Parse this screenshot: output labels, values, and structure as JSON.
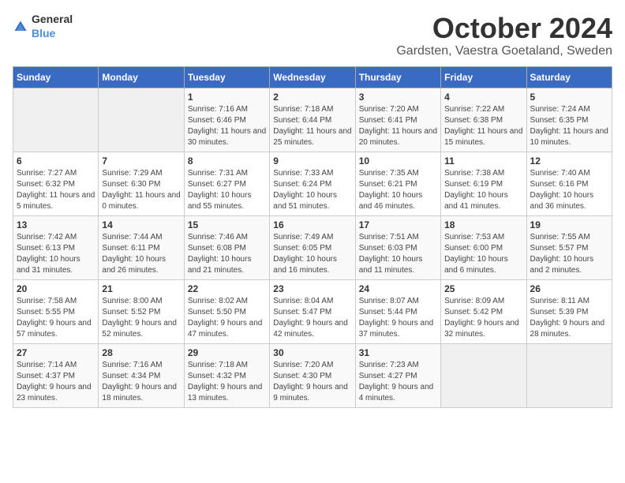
{
  "logo": {
    "general": "General",
    "blue": "Blue"
  },
  "header": {
    "month_year": "October 2024",
    "location": "Gardsten, Vaestra Goetaland, Sweden"
  },
  "weekdays": [
    "Sunday",
    "Monday",
    "Tuesday",
    "Wednesday",
    "Thursday",
    "Friday",
    "Saturday"
  ],
  "weeks": [
    [
      {
        "day": "",
        "sunrise": "",
        "sunset": "",
        "daylight": ""
      },
      {
        "day": "",
        "sunrise": "",
        "sunset": "",
        "daylight": ""
      },
      {
        "day": "1",
        "sunrise": "Sunrise: 7:16 AM",
        "sunset": "Sunset: 6:46 PM",
        "daylight": "Daylight: 11 hours and 30 minutes."
      },
      {
        "day": "2",
        "sunrise": "Sunrise: 7:18 AM",
        "sunset": "Sunset: 6:44 PM",
        "daylight": "Daylight: 11 hours and 25 minutes."
      },
      {
        "day": "3",
        "sunrise": "Sunrise: 7:20 AM",
        "sunset": "Sunset: 6:41 PM",
        "daylight": "Daylight: 11 hours and 20 minutes."
      },
      {
        "day": "4",
        "sunrise": "Sunrise: 7:22 AM",
        "sunset": "Sunset: 6:38 PM",
        "daylight": "Daylight: 11 hours and 15 minutes."
      },
      {
        "day": "5",
        "sunrise": "Sunrise: 7:24 AM",
        "sunset": "Sunset: 6:35 PM",
        "daylight": "Daylight: 11 hours and 10 minutes."
      }
    ],
    [
      {
        "day": "6",
        "sunrise": "Sunrise: 7:27 AM",
        "sunset": "Sunset: 6:32 PM",
        "daylight": "Daylight: 11 hours and 5 minutes."
      },
      {
        "day": "7",
        "sunrise": "Sunrise: 7:29 AM",
        "sunset": "Sunset: 6:30 PM",
        "daylight": "Daylight: 11 hours and 0 minutes."
      },
      {
        "day": "8",
        "sunrise": "Sunrise: 7:31 AM",
        "sunset": "Sunset: 6:27 PM",
        "daylight": "Daylight: 10 hours and 55 minutes."
      },
      {
        "day": "9",
        "sunrise": "Sunrise: 7:33 AM",
        "sunset": "Sunset: 6:24 PM",
        "daylight": "Daylight: 10 hours and 51 minutes."
      },
      {
        "day": "10",
        "sunrise": "Sunrise: 7:35 AM",
        "sunset": "Sunset: 6:21 PM",
        "daylight": "Daylight: 10 hours and 46 minutes."
      },
      {
        "day": "11",
        "sunrise": "Sunrise: 7:38 AM",
        "sunset": "Sunset: 6:19 PM",
        "daylight": "Daylight: 10 hours and 41 minutes."
      },
      {
        "day": "12",
        "sunrise": "Sunrise: 7:40 AM",
        "sunset": "Sunset: 6:16 PM",
        "daylight": "Daylight: 10 hours and 36 minutes."
      }
    ],
    [
      {
        "day": "13",
        "sunrise": "Sunrise: 7:42 AM",
        "sunset": "Sunset: 6:13 PM",
        "daylight": "Daylight: 10 hours and 31 minutes."
      },
      {
        "day": "14",
        "sunrise": "Sunrise: 7:44 AM",
        "sunset": "Sunset: 6:11 PM",
        "daylight": "Daylight: 10 hours and 26 minutes."
      },
      {
        "day": "15",
        "sunrise": "Sunrise: 7:46 AM",
        "sunset": "Sunset: 6:08 PM",
        "daylight": "Daylight: 10 hours and 21 minutes."
      },
      {
        "day": "16",
        "sunrise": "Sunrise: 7:49 AM",
        "sunset": "Sunset: 6:05 PM",
        "daylight": "Daylight: 10 hours and 16 minutes."
      },
      {
        "day": "17",
        "sunrise": "Sunrise: 7:51 AM",
        "sunset": "Sunset: 6:03 PM",
        "daylight": "Daylight: 10 hours and 11 minutes."
      },
      {
        "day": "18",
        "sunrise": "Sunrise: 7:53 AM",
        "sunset": "Sunset: 6:00 PM",
        "daylight": "Daylight: 10 hours and 6 minutes."
      },
      {
        "day": "19",
        "sunrise": "Sunrise: 7:55 AM",
        "sunset": "Sunset: 5:57 PM",
        "daylight": "Daylight: 10 hours and 2 minutes."
      }
    ],
    [
      {
        "day": "20",
        "sunrise": "Sunrise: 7:58 AM",
        "sunset": "Sunset: 5:55 PM",
        "daylight": "Daylight: 9 hours and 57 minutes."
      },
      {
        "day": "21",
        "sunrise": "Sunrise: 8:00 AM",
        "sunset": "Sunset: 5:52 PM",
        "daylight": "Daylight: 9 hours and 52 minutes."
      },
      {
        "day": "22",
        "sunrise": "Sunrise: 8:02 AM",
        "sunset": "Sunset: 5:50 PM",
        "daylight": "Daylight: 9 hours and 47 minutes."
      },
      {
        "day": "23",
        "sunrise": "Sunrise: 8:04 AM",
        "sunset": "Sunset: 5:47 PM",
        "daylight": "Daylight: 9 hours and 42 minutes."
      },
      {
        "day": "24",
        "sunrise": "Sunrise: 8:07 AM",
        "sunset": "Sunset: 5:44 PM",
        "daylight": "Daylight: 9 hours and 37 minutes."
      },
      {
        "day": "25",
        "sunrise": "Sunrise: 8:09 AM",
        "sunset": "Sunset: 5:42 PM",
        "daylight": "Daylight: 9 hours and 32 minutes."
      },
      {
        "day": "26",
        "sunrise": "Sunrise: 8:11 AM",
        "sunset": "Sunset: 5:39 PM",
        "daylight": "Daylight: 9 hours and 28 minutes."
      }
    ],
    [
      {
        "day": "27",
        "sunrise": "Sunrise: 7:14 AM",
        "sunset": "Sunset: 4:37 PM",
        "daylight": "Daylight: 9 hours and 23 minutes."
      },
      {
        "day": "28",
        "sunrise": "Sunrise: 7:16 AM",
        "sunset": "Sunset: 4:34 PM",
        "daylight": "Daylight: 9 hours and 18 minutes."
      },
      {
        "day": "29",
        "sunrise": "Sunrise: 7:18 AM",
        "sunset": "Sunset: 4:32 PM",
        "daylight": "Daylight: 9 hours and 13 minutes."
      },
      {
        "day": "30",
        "sunrise": "Sunrise: 7:20 AM",
        "sunset": "Sunset: 4:30 PM",
        "daylight": "Daylight: 9 hours and 9 minutes."
      },
      {
        "day": "31",
        "sunrise": "Sunrise: 7:23 AM",
        "sunset": "Sunset: 4:27 PM",
        "daylight": "Daylight: 9 hours and 4 minutes."
      },
      {
        "day": "",
        "sunrise": "",
        "sunset": "",
        "daylight": ""
      },
      {
        "day": "",
        "sunrise": "",
        "sunset": "",
        "daylight": ""
      }
    ]
  ]
}
